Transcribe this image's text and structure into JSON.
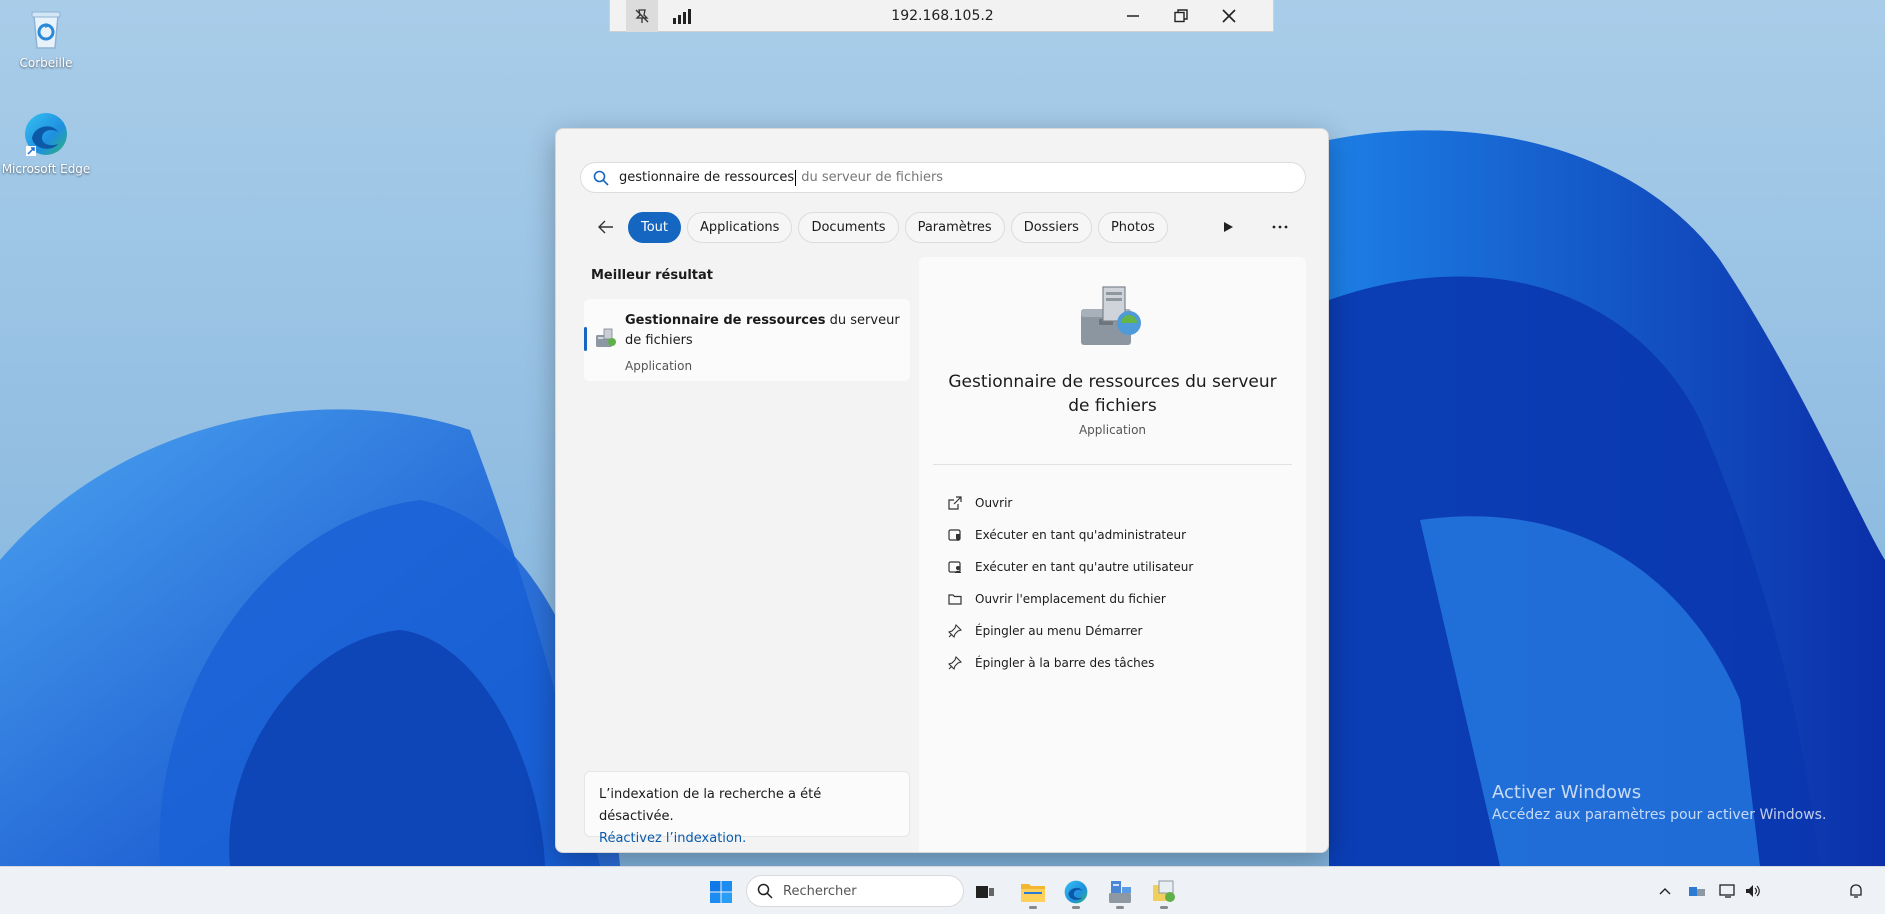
{
  "desktop": {
    "icons": [
      {
        "label": "Corbeille",
        "icon": "recycle-bin-icon"
      },
      {
        "label": "Microsoft Edge",
        "icon": "edge-icon"
      }
    ]
  },
  "rdp_bar": {
    "title": "192.168.105.2",
    "icons": [
      "pin-icon",
      "signal-icon",
      "minimize-icon",
      "restore-icon",
      "close-icon"
    ]
  },
  "search": {
    "typed": "gestionnaire de ressources",
    "suggestion": " du serveur de fichiers",
    "filters": [
      "Tout",
      "Applications",
      "Documents",
      "Paramètres",
      "Dossiers",
      "Photos"
    ],
    "active_filter": "Tout"
  },
  "best_result": {
    "heading": "Meilleur résultat",
    "bold": "Gestionnaire de ressources",
    "rest": " du serveur de fichiers",
    "type": "Application"
  },
  "details": {
    "title": "Gestionnaire de ressources du serveur de fichiers",
    "type": "Application",
    "actions": [
      {
        "label": "Ouvrir",
        "icon": "open-external-icon"
      },
      {
        "label": "Exécuter en tant qu'administrateur",
        "icon": "shield-admin-icon"
      },
      {
        "label": "Exécuter en tant qu'autre utilisateur",
        "icon": "user-switch-icon"
      },
      {
        "label": "Ouvrir l'emplacement du fichier",
        "icon": "folder-icon"
      },
      {
        "label": "Épingler au menu Démarrer",
        "icon": "pin-icon"
      },
      {
        "label": "Épingler à la barre des tâches",
        "icon": "pin-icon"
      }
    ]
  },
  "index_notice": {
    "text": "L’indexation de la recherche a été désactivée.",
    "link": "Réactivez l’indexation."
  },
  "watermark": {
    "title": "Activer Windows",
    "subtitle": "Accédez aux paramètres pour activer Windows."
  },
  "taskbar": {
    "search_placeholder": "Rechercher",
    "apps": [
      "task-view-icon",
      "file-explorer-icon",
      "edge-icon",
      "server-manager-icon",
      "file-server-icon"
    ],
    "tray": [
      "chevron-up-icon",
      "network-adapter-icon",
      "display-icon",
      "volume-icon",
      "notification-bell-icon"
    ]
  },
  "colors": {
    "accent": "#1466c0",
    "link": "#0b5cad"
  }
}
